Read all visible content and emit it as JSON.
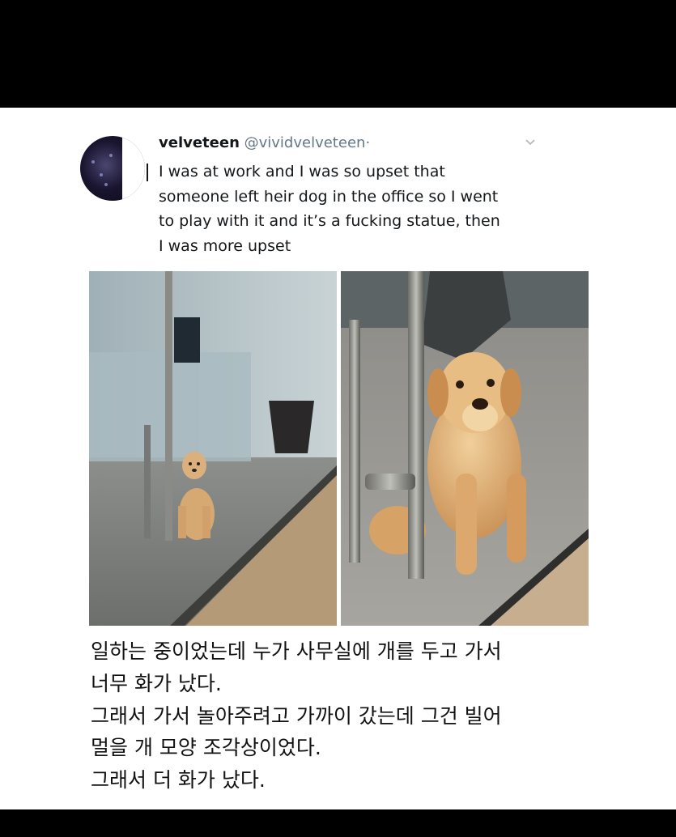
{
  "tweet": {
    "display_name": "velveteen",
    "handle": "@vividvelveteen",
    "separator": "·",
    "text": "I was at work and I was so upset that someone left heir dog in the office so I went to play with it and it’s a fucking statue, then I was more upset",
    "avatar_icon": "avatar-icon",
    "menu_icon": "chevron-down-icon"
  },
  "images": [
    {
      "name": "dog-statue-behind-glass-wide",
      "alt": "dog statue in office"
    },
    {
      "name": "dog-statue-behind-glass-close",
      "alt": "dog statue close up"
    }
  ],
  "caption": {
    "lines": [
      "일하는 중이었는데 누가 사무실에 개를 두고 가서",
      "너무 화가 났다.",
      "그래서 가서 놀아주려고 가까이 갔는데 그건 빌어",
      "멀을 개 모양 조각상이었다.",
      "그래서 더 화가 났다."
    ]
  },
  "colors": {
    "background": "#000000",
    "card": "#ffffff",
    "text": "#14171a",
    "muted": "#657786"
  }
}
